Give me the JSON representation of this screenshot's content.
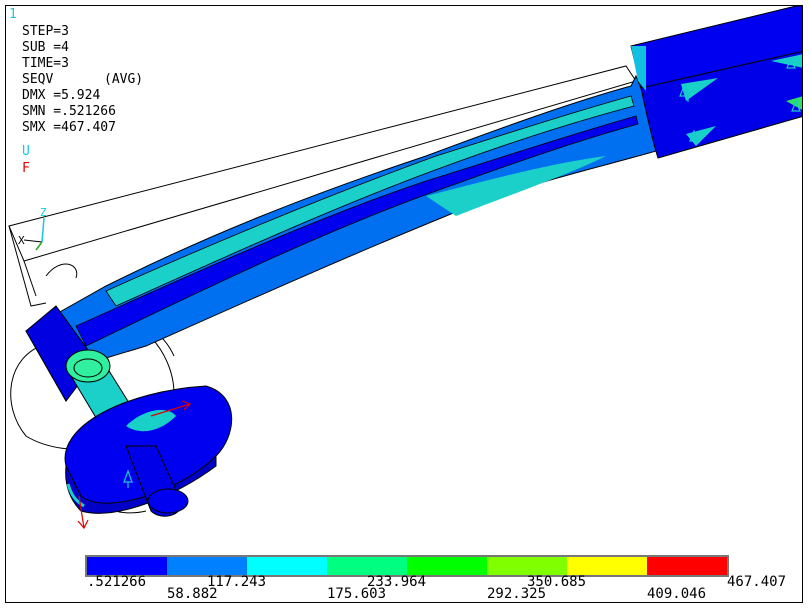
{
  "window_number": "1",
  "info": {
    "step": "STEP=3",
    "sub": "SUB =4",
    "time": "TIME=3",
    "result": "SEQV",
    "avg": "(AVG)",
    "dmx": "DMX =5.924",
    "smn": "SMN =.521266",
    "smx": "SMX =467.407"
  },
  "symbols": {
    "u": "U",
    "f": "F"
  },
  "triad": {
    "z": "Z",
    "x": "X"
  },
  "legend": {
    "colors": [
      "#0000ff",
      "#0080ff",
      "#00ffff",
      "#00ff80",
      "#00ff00",
      "#80ff00",
      "#ffff00",
      "#ff0000"
    ],
    "labels_lower": [
      ".521266",
      "117.243",
      "233.964",
      "350.685",
      "467.407"
    ],
    "labels_upper": [
      "58.882",
      "175.603",
      "292.325",
      "409.046"
    ]
  },
  "colors": {
    "accent_cyan": "#19c8d8",
    "force_red": "#e00000"
  }
}
